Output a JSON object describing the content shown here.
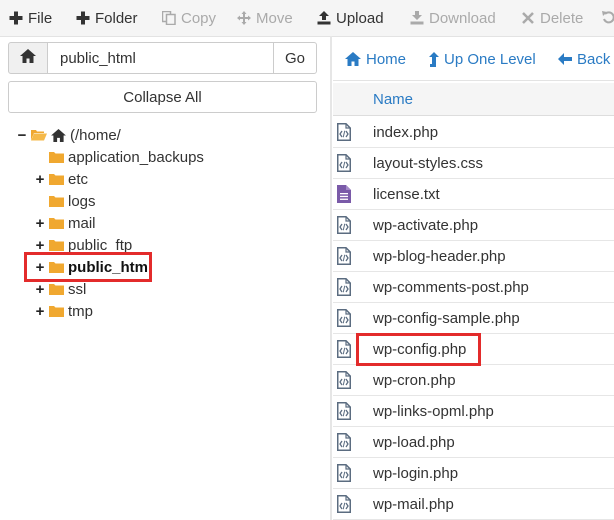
{
  "toolbar": {
    "buttons": [
      {
        "label": "File",
        "icon": "plus-icon",
        "enabled": true
      },
      {
        "label": "Folder",
        "icon": "plus-icon",
        "enabled": true
      },
      {
        "label": "Copy",
        "icon": "copy-icon",
        "enabled": false
      },
      {
        "label": "Move",
        "icon": "move-arrows-icon",
        "enabled": false
      },
      {
        "label": "Upload",
        "icon": "upload-icon",
        "enabled": true
      },
      {
        "label": "Download",
        "icon": "download-icon",
        "enabled": false
      },
      {
        "label": "Delete",
        "icon": "times-icon",
        "enabled": false
      }
    ]
  },
  "path_bar": {
    "value": "public_html",
    "go_label": "Go"
  },
  "collapse_label": "Collapse All",
  "tree": {
    "root": "(/home/",
    "items": [
      {
        "label": "application_backups",
        "expandable": false
      },
      {
        "label": "etc",
        "expandable": true
      },
      {
        "label": "logs",
        "expandable": false
      },
      {
        "label": "mail",
        "expandable": true
      },
      {
        "label": "public_ftp",
        "expandable": true
      },
      {
        "label": "public_html",
        "expandable": true,
        "selected": true
      },
      {
        "label": "ssl",
        "expandable": true
      },
      {
        "label": "tmp",
        "expandable": true
      }
    ]
  },
  "nav": {
    "home": "Home",
    "up_one_level": "Up One Level",
    "back": "Back"
  },
  "files": {
    "column_name": "Name",
    "rows": [
      {
        "name": "index.php",
        "type": "code"
      },
      {
        "name": "layout-styles.css",
        "type": "code"
      },
      {
        "name": "license.txt",
        "type": "text"
      },
      {
        "name": "wp-activate.php",
        "type": "code"
      },
      {
        "name": "wp-blog-header.php",
        "type": "code"
      },
      {
        "name": "wp-comments-post.php",
        "type": "code"
      },
      {
        "name": "wp-config-sample.php",
        "type": "code"
      },
      {
        "name": "wp-config.php",
        "type": "code",
        "highlighted": true
      },
      {
        "name": "wp-cron.php",
        "type": "code"
      },
      {
        "name": "wp-links-opml.php",
        "type": "code"
      },
      {
        "name": "wp-load.php",
        "type": "code"
      },
      {
        "name": "wp-login.php",
        "type": "code"
      },
      {
        "name": "wp-mail.php",
        "type": "code"
      }
    ]
  },
  "colors": {
    "accent": "#2a7bc4",
    "folder": "#f0a830",
    "highlight": "#e32b2b",
    "text_file": "#7a5aa8",
    "disabled": "#aaaaaa"
  }
}
